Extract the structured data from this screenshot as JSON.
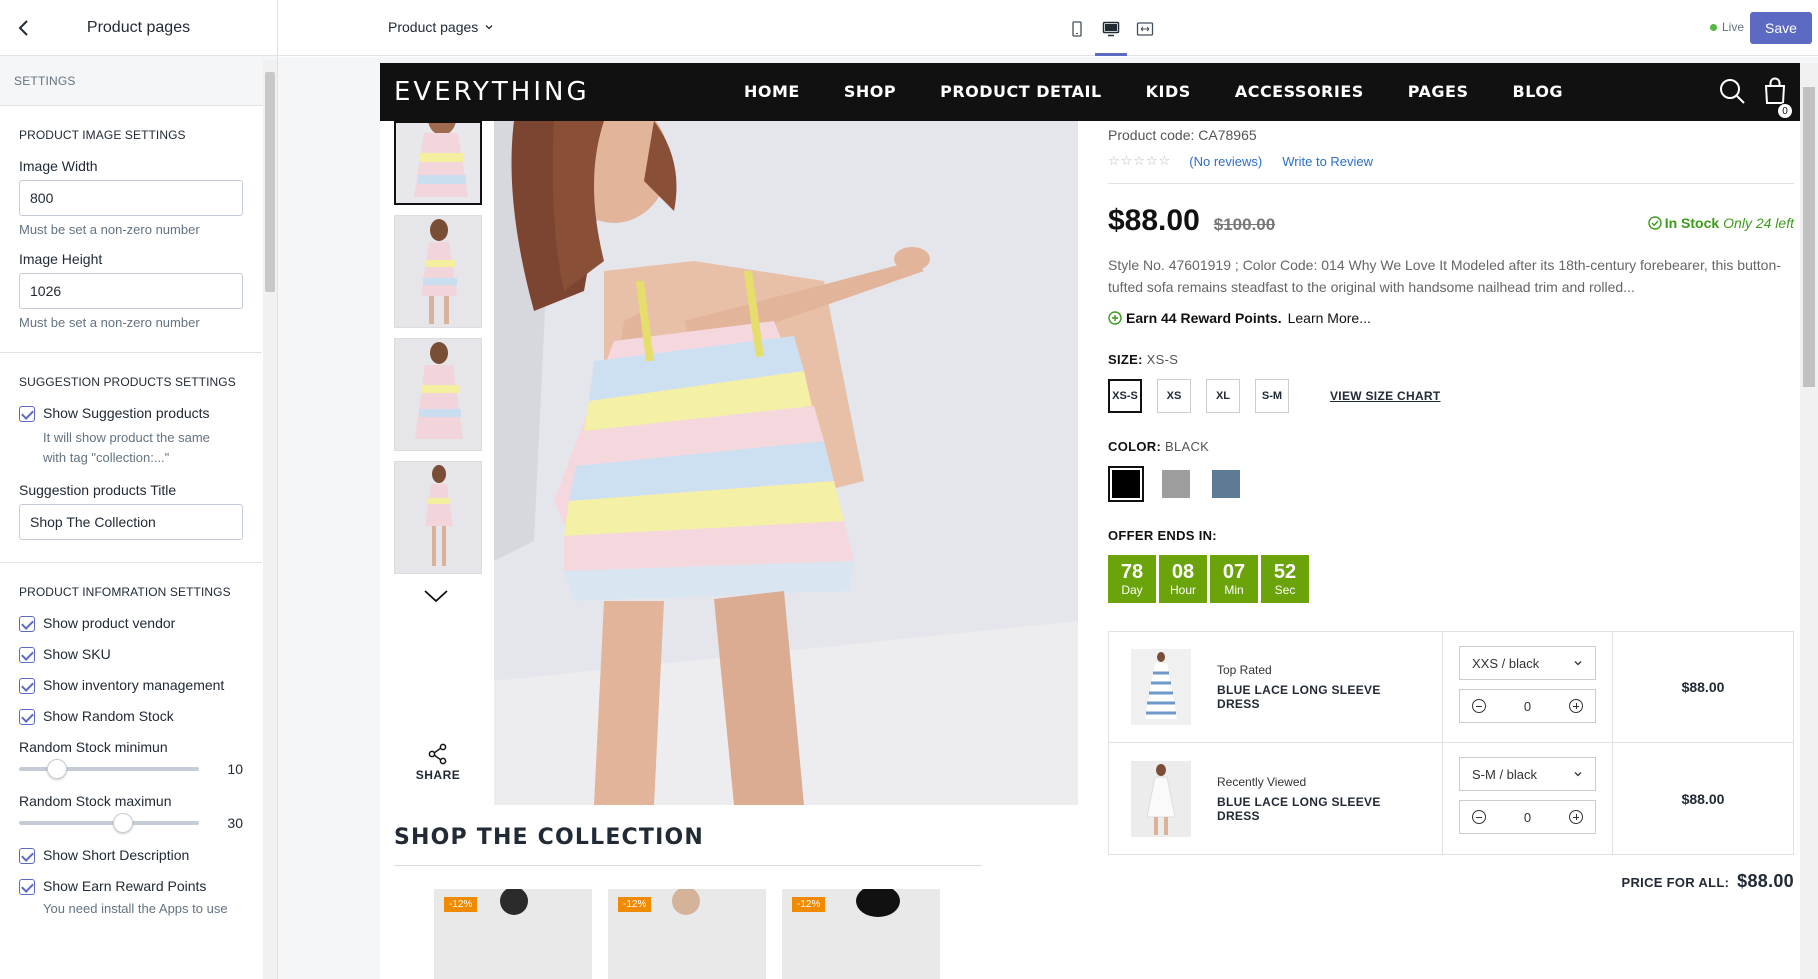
{
  "sidebar": {
    "title": "Product pages",
    "settings_label": "SETTINGS",
    "image_section": {
      "title": "PRODUCT IMAGE SETTINGS",
      "width_label": "Image Width",
      "width_value": "800",
      "width_help": "Must be set a non-zero number",
      "height_label": "Image Height",
      "height_value": "1026",
      "height_help": "Must be set a non-zero number"
    },
    "suggestion_section": {
      "title": "SUGGESTION PRODUCTS SETTINGS",
      "show_label": "Show Suggestion products",
      "show_help": "It will show product the same with tag \"collection:...\"",
      "title_label": "Suggestion products Title",
      "title_value": "Shop The Collection"
    },
    "info_section": {
      "title": "PRODUCT INFOMRATION SETTINGS",
      "vendor": "Show product vendor",
      "sku": "Show SKU",
      "inventory": "Show inventory management",
      "random_stock": "Show Random Stock",
      "min_label": "Random Stock minimun",
      "min_value": "10",
      "max_label": "Random Stock maximun",
      "max_value": "30",
      "short_desc": "Show Short Description",
      "reward": "Show Earn Reward Points",
      "reward_help": "You need install the Apps to use"
    }
  },
  "topbar": {
    "page_select": "Product pages",
    "live_label": "Live",
    "save_label": "Save"
  },
  "store": {
    "logo": "EVERYTHING",
    "nav": [
      "HOME",
      "SHOP",
      "PRODUCT DETAIL",
      "KIDS",
      "ACCESSORIES",
      "PAGES",
      "BLOG"
    ],
    "cart_count": "0",
    "share_label": "SHARE",
    "product": {
      "code": "Product code: CA78965",
      "stars": "☆☆☆☆☆",
      "no_reviews": "(No reviews)",
      "write_review": "Write to Review",
      "price": "$88.00",
      "compare_price": "$100.00",
      "stock_label": "In Stock",
      "stock_left": "Only 24 left",
      "description": "Style No. 47601919 ; Color Code: 014 Why We Love It Modeled after its 18th-century forebearer, this button-tufted sofa remains steadfast to the original with handsome nailhead trim and rolled...",
      "reward_text": "Earn 44 Reward Points.",
      "reward_link": "Learn More...",
      "size_label": "SIZE:",
      "size_value": "XS-S",
      "sizes": [
        "XS-S",
        "XS",
        "XL",
        "S-M"
      ],
      "size_chart": "VIEW SIZE CHART",
      "color_label": "COLOR:",
      "color_value": "BLACK",
      "colors": [
        "#000000",
        "#9e9e9e",
        "#5e7b96"
      ],
      "offer_label": "OFFER ENDS IN:",
      "countdown": [
        {
          "num": "78",
          "unit": "Day"
        },
        {
          "num": "08",
          "unit": "Hour"
        },
        {
          "num": "07",
          "unit": "Min"
        },
        {
          "num": "52",
          "unit": "Sec"
        }
      ]
    },
    "bundle": [
      {
        "tag": "Top Rated",
        "name": "BLUE LACE LONG SLEEVE DRESS",
        "variant": "XXS / black",
        "qty": "0",
        "price": "$88.00"
      },
      {
        "tag": "Recently Viewed",
        "name": "BLUE LACE LONG SLEEVE DRESS",
        "variant": "S-M / black",
        "qty": "0",
        "price": "$88.00"
      }
    ],
    "total_label": "PRICE FOR ALL:",
    "total_value": "$88.00",
    "collection_title": "SHOP THE COLLECTION",
    "collection_badges": [
      "-12%",
      "-12%",
      "-12%"
    ]
  },
  "colors": {
    "accent": "#5c6ac4",
    "stock_green": "#3c9b1a",
    "countdown_green": "#6aa30a",
    "nav_bg": "#111111"
  }
}
